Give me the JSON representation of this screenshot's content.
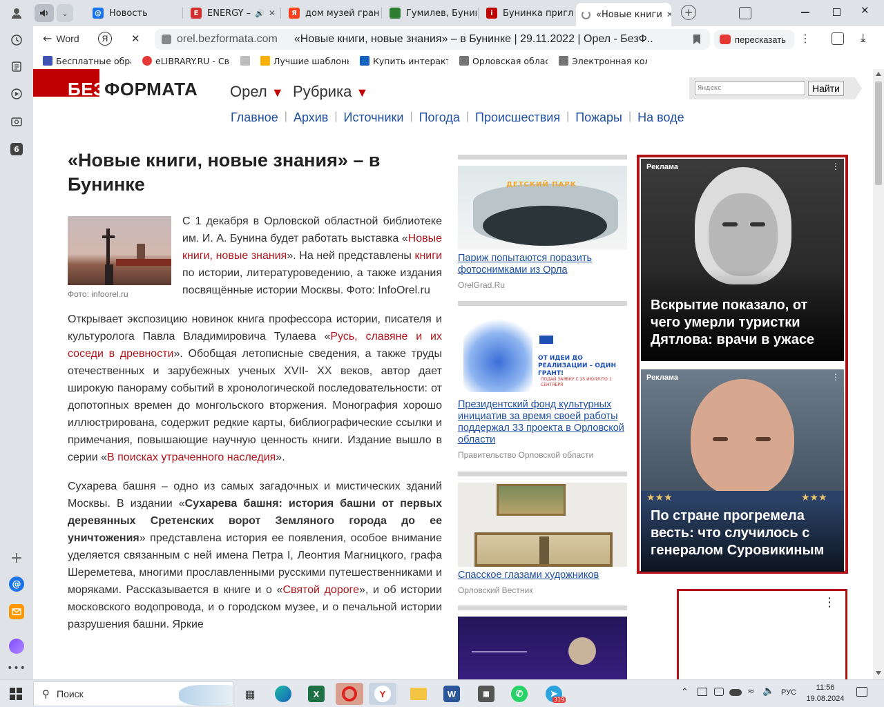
{
  "tabs": [
    {
      "title": "Новость",
      "icon": "at-icon",
      "color": "#1a73e8"
    },
    {
      "title": "ENERGY –",
      "icon": "energy-icon",
      "color": "#d32f2f"
    },
    {
      "title": "дом музей гран",
      "icon": "yandex-icon",
      "color": "#fc3f1d"
    },
    {
      "title": "Гумилев, Бунин",
      "icon": "site-icon",
      "color": "#2e7d32"
    },
    {
      "title": "Бунинка пригла",
      "icon": "site-icon",
      "color": "#c00000"
    },
    {
      "title": "«Новые книги",
      "icon": "spinner-icon",
      "color": "#888888"
    }
  ],
  "nav": {
    "back_label": "Word",
    "url_domain": "orel.bezformata.com",
    "page_title": "«Новые книги, новые знания» – в Бунинке | 29.11.2022 | Орел - БезФ...",
    "retell_label": "пересказать"
  },
  "bookmarks": [
    {
      "label": "Бесплатные обра",
      "color": "#3f51b5"
    },
    {
      "label": "eLIBRARY.RU - Св",
      "color": "#e53935"
    },
    {
      "label": "",
      "color": "#9e9e9e"
    },
    {
      "label": "Лучшие шаблоны",
      "color": "#ffb300"
    },
    {
      "label": "Купить интеракти",
      "color": "#1565c0"
    },
    {
      "label": "Орловская облас",
      "color": "#757575"
    },
    {
      "label": "Электронная кол",
      "color": "#757575"
    }
  ],
  "site": {
    "logo_bez": "БЕЗ",
    "logo_fmt": "ФОРМАТА",
    "city": "Орел",
    "rubric": "Рубрика",
    "search_placeholder": "Яндекс",
    "search_button": "Найти",
    "menu": [
      "Главное",
      "Архив",
      "Источники",
      "Погода",
      "Происшествия",
      "Пожары",
      "На воде"
    ]
  },
  "article": {
    "title": "«Новые книги, новые знания» – в Бунинке",
    "photo_caption_prefix": "Фото: ",
    "photo_caption_src": "infoorel.ru",
    "p1_a": "С 1 декабря в Орловской областной библиотеке им. И. А. Бунина будет работать выставка «",
    "p1_link1": "Новые книги, новые знания",
    "p1_b": "». На ней представлены ",
    "p1_link2": "книги",
    "p1_c": " по истории, литературоведению, а также издания посвящённые истории Москвы. Фото: InfoOrel.ru",
    "p2_a": "Открывает экспозицию новинок книга профессора истории, писателя и культуролога Павла Владимировича Тулаева «",
    "p2_link1": "Русь, славяне и их соседи в древности",
    "p2_b": "». Обобщая летописные сведения, а также труды отечественных и зарубежных ученых XVII- XX веков, автор дает широкую панораму событий в хронологической последовательности: от допотопных времен до монгольского вторжения. Монография хорошо иллюстрирована, содержит редкие карты, библиографические ссылки и примечания, повышающие научную ценность книги. Издание вышло в серии «",
    "p2_link2": "В поисках утраченного наследия",
    "p2_c": "».",
    "p3_a": "Сухарева башня – одно из самых загадочных и мистических зданий Москвы. В издании «",
    "p3_bold": "Сухарева башня: история башни от первых деревянных Сретенских ворот Земляного города до ее уничтожения",
    "p3_b": "» представлена история ее появления, особое внимание уделяется связанным с ней имена Петра I, Леонтия Магницкого, графа Шереметева, многими прославленными русскими путешественниками и моряками. Рассказывается в книге и о «",
    "p3_link": "Святой дороге",
    "p3_c": "», и об истории московского водопровода, и о городском музее, и о печальной истории разрушения башни. Яркие"
  },
  "news": [
    {
      "title": "Париж попытаются поразить фотоснимками из Орла",
      "source": "OrelGrad.Ru",
      "img_text": "ДЕТСКИЙ ПАРК"
    },
    {
      "title": "Президентский фонд культурных инициатив за время своей работы поддержал 33 проекта в Орловской области",
      "source": "Правительство Орловской области",
      "img_text1": "ОТ ИДЕИ ДО РЕАЛИЗАЦИИ – ОДИН ГРАНТ!",
      "img_text2": "ПОДАЙ ЗАЯВКУ С 25 ИЮЛЯ ПО 1 СЕНТЯБРЯ"
    },
    {
      "title": "Спасское глазами художников",
      "source": "Орловский Вестник"
    }
  ],
  "ads": [
    {
      "label": "Реклама",
      "title": "Вскрытие показало, от чего умерли туристки Дятлова: врачи в ужасе"
    },
    {
      "label": "Реклама",
      "title": "По стране прогремела весть: что случилось с генералом Суровикиным"
    }
  ],
  "taskbar": {
    "search_label": "Поиск",
    "lang": "РУС",
    "time": "11:56",
    "date": "19.08.2024",
    "telegram_badge": "319"
  }
}
